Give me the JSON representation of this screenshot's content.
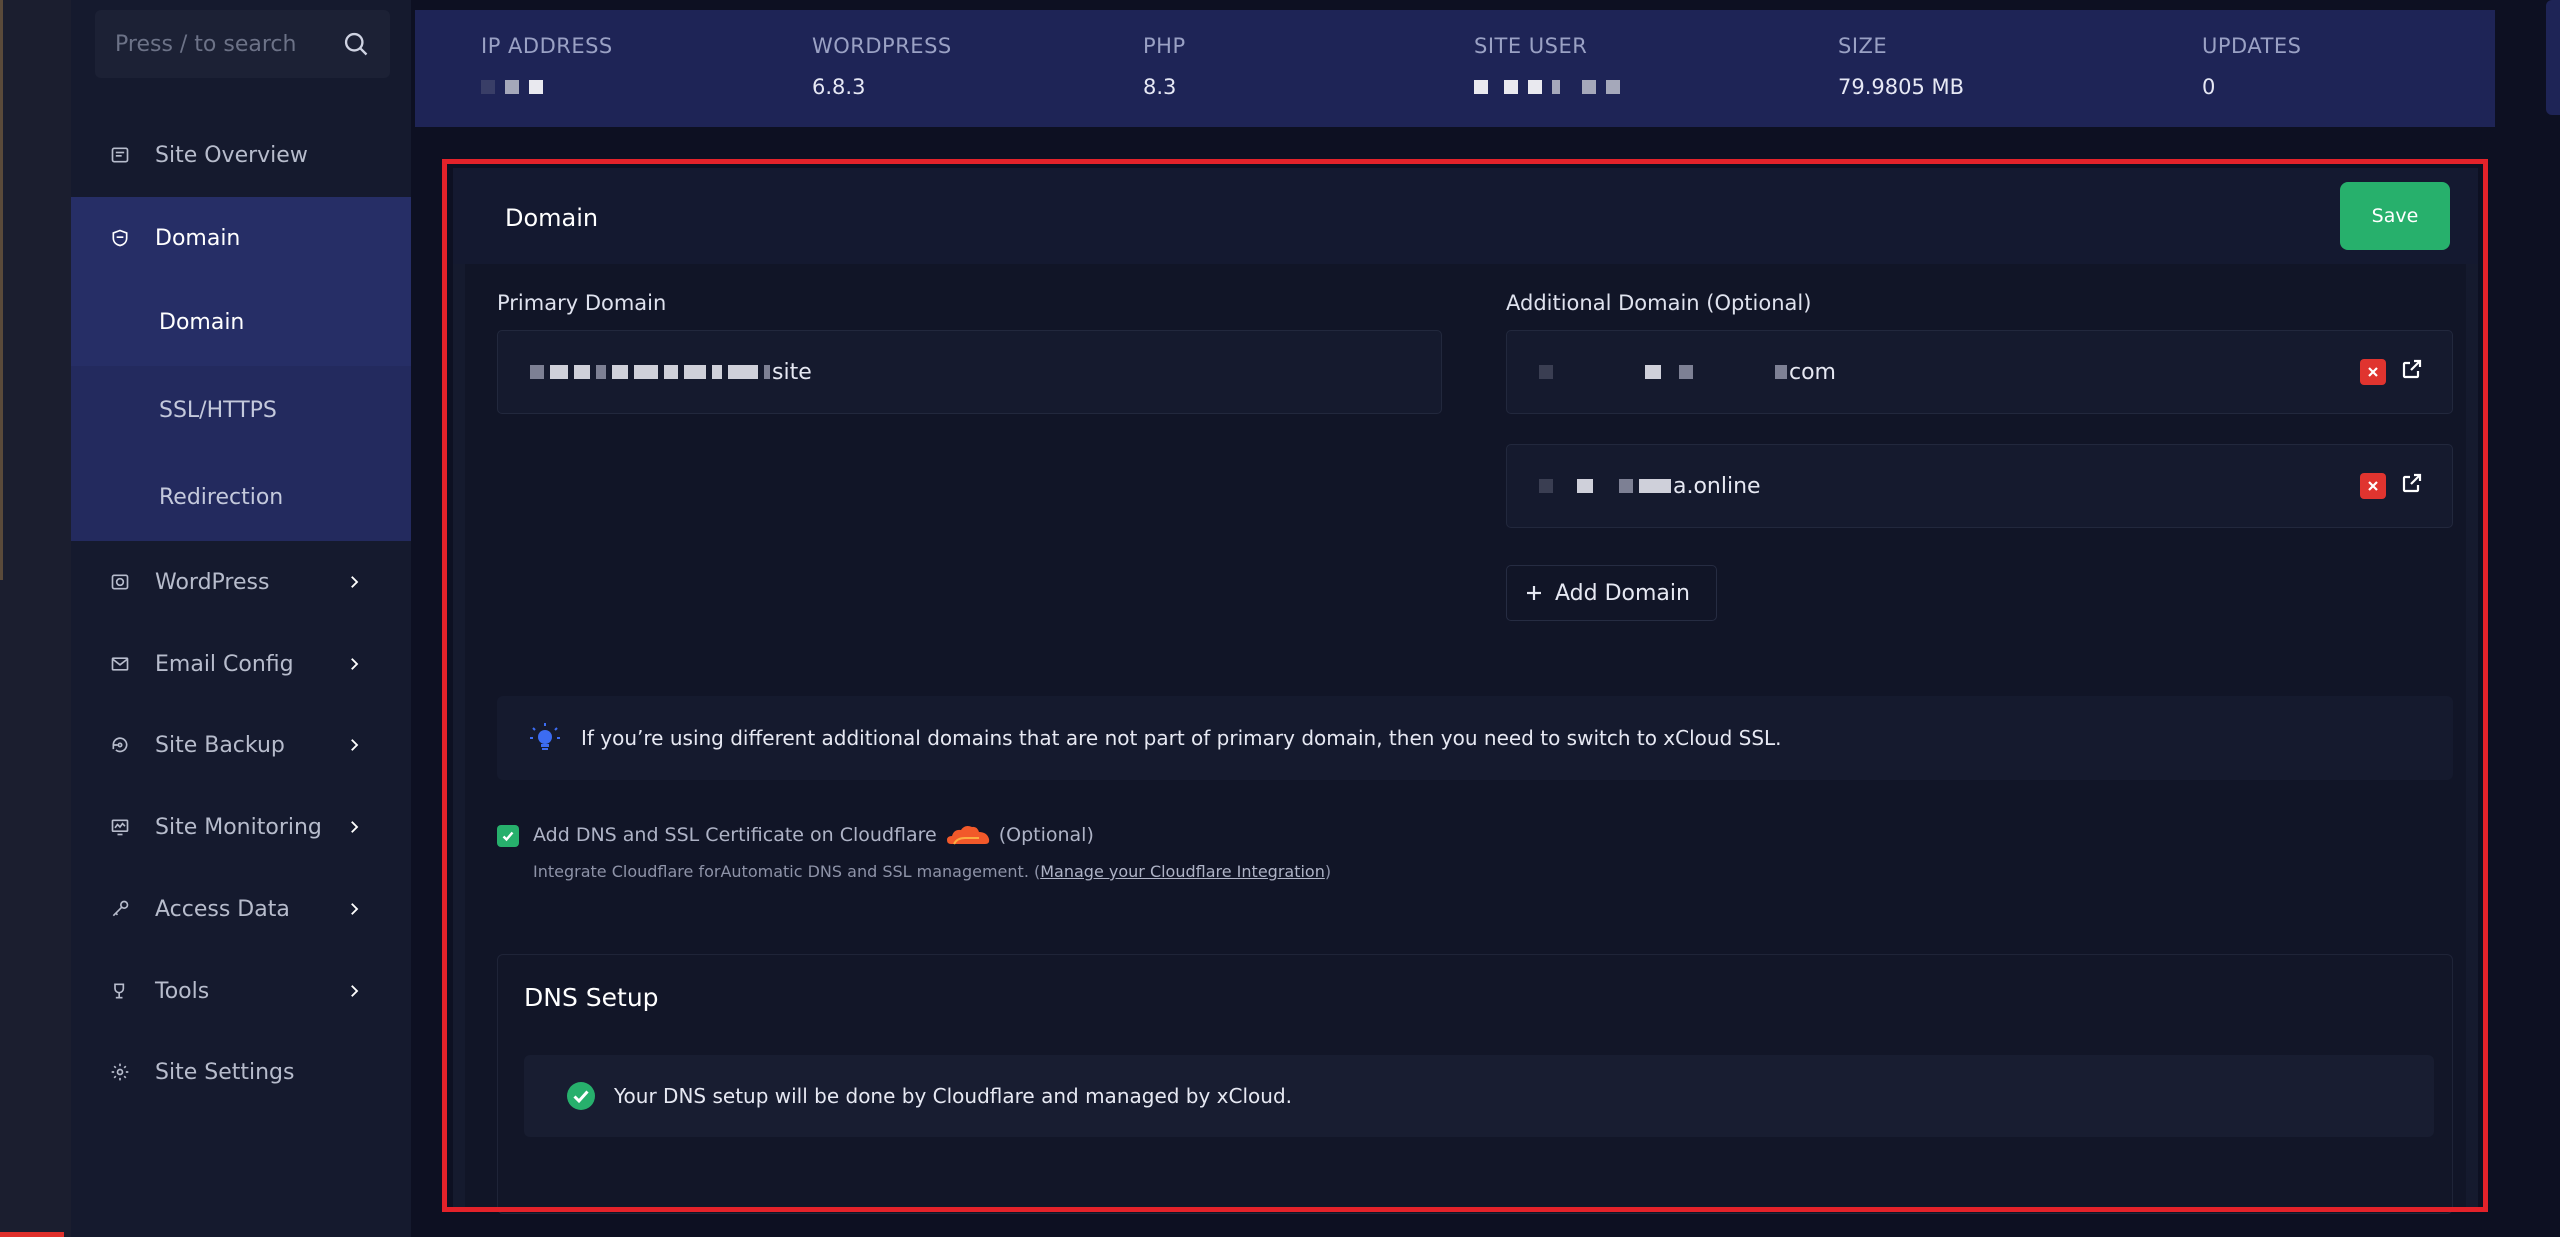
{
  "sidebar": {
    "search_placeholder": "Press / to search",
    "nav": [
      {
        "label": "Site Overview",
        "icon": "site-overview-icon"
      },
      {
        "label": "Domain",
        "icon": "shield-icon"
      },
      {
        "label": "WordPress",
        "icon": "wordpress-icon"
      },
      {
        "label": "Email Config",
        "icon": "mail-icon"
      },
      {
        "label": "Site Backup",
        "icon": "backup-icon"
      },
      {
        "label": "Site Monitoring",
        "icon": "monitor-icon"
      },
      {
        "label": "Access Data",
        "icon": "key-icon"
      },
      {
        "label": "Tools",
        "icon": "tools-icon"
      },
      {
        "label": "Site Settings",
        "icon": "gear-icon"
      }
    ],
    "submenu": [
      {
        "label": "Domain"
      },
      {
        "label": "SSL/HTTPS"
      },
      {
        "label": "Redirection"
      }
    ]
  },
  "infobar": {
    "ip_label": "IP ADDRESS",
    "wordpress_label": "WORDPRESS",
    "wordpress_value": "6.8.3",
    "php_label": "PHP",
    "php_value": "8.3",
    "site_user_label": "SITE USER",
    "size_label": "SIZE",
    "size_value": "79.9805 MB",
    "updates_label": "UPDATES",
    "updates_value": "0"
  },
  "panel": {
    "title": "Domain",
    "save_label": "Save",
    "primary_label": "Primary Domain",
    "primary_value_suffix": "site",
    "additional_label": "Additional Domain (Optional)",
    "additional_domains": [
      {
        "value_suffix": "com"
      },
      {
        "value_suffix": "a.online"
      }
    ],
    "add_domain_label": "Add Domain",
    "ssl_note": "If you’re using different additional domains that are not part of primary domain, then you need to switch to xCloud SSL.",
    "cloudflare_label": "Add DNS and SSL Certificate on Cloudflare",
    "cloudflare_optional": "(Optional)",
    "cloudflare_desc": "Integrate Cloudflare forAutomatic DNS and SSL management. (",
    "cloudflare_link": "Manage your Cloudflare Integration",
    "cloudflare_desc_end": ")",
    "dns_title": "DNS Setup",
    "dns_message": "Your DNS setup will be done by Cloudflare and managed by xCloud."
  },
  "colors": {
    "accent_green": "#27b06c",
    "danger_red": "#e0342f",
    "highlight_border": "#e3222a",
    "cloudflare_orange": "#f2592a",
    "nav_active": "#262e66"
  }
}
